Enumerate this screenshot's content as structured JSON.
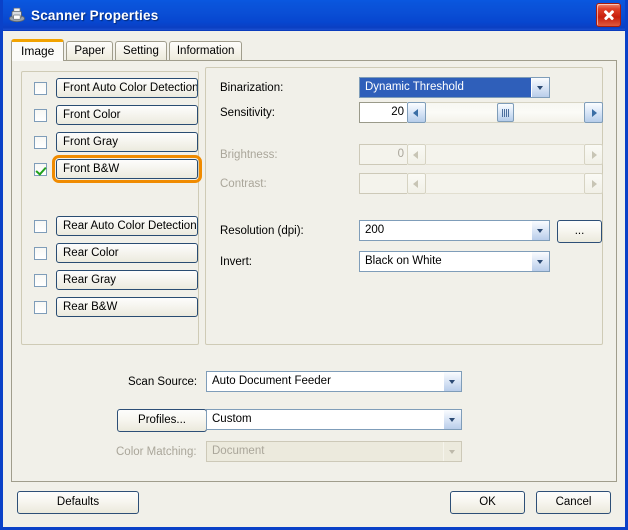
{
  "window": {
    "title": "Scanner Properties",
    "icon": "scanner-icon",
    "close_label": "",
    "accent_title_color": "#0a4fd6",
    "focus_color": "#f08b00"
  },
  "tabs": [
    {
      "label": "Image",
      "active": true
    },
    {
      "label": "Paper",
      "active": false
    },
    {
      "label": "Setting",
      "active": false
    },
    {
      "label": "Information",
      "active": false
    }
  ],
  "color_modes": {
    "front": [
      {
        "label": "Front Auto Color Detection",
        "checked": false,
        "focused": false
      },
      {
        "label": "Front Color",
        "checked": false,
        "focused": false
      },
      {
        "label": "Front Gray",
        "checked": false,
        "focused": false
      },
      {
        "label": "Front B&W",
        "checked": true,
        "focused": true
      }
    ],
    "rear": [
      {
        "label": "Rear Auto Color Detection",
        "checked": false,
        "focused": false
      },
      {
        "label": "Rear Color",
        "checked": false,
        "focused": false
      },
      {
        "label": "Rear Gray",
        "checked": false,
        "focused": false
      },
      {
        "label": "Rear B&W",
        "checked": false,
        "focused": false
      }
    ]
  },
  "settings": {
    "binarization": {
      "label": "Binarization:",
      "value": "Dynamic Threshold",
      "enabled": true,
      "text_selected": true
    },
    "sensitivity": {
      "label": "Sensitivity:",
      "value": "20",
      "enabled": true,
      "thumb_percent": 50
    },
    "brightness": {
      "label": "Brightness:",
      "value": "0",
      "enabled": false
    },
    "contrast": {
      "label": "Contrast:",
      "value": "",
      "enabled": false
    },
    "resolution": {
      "label": "Resolution (dpi):",
      "value": "200",
      "enabled": true,
      "browse_label": "..."
    },
    "invert": {
      "label": "Invert:",
      "value": "Black on White",
      "enabled": true
    }
  },
  "footer_fields": {
    "scan_source": {
      "label": "Scan Source:",
      "value": "Auto Document Feeder",
      "enabled": true
    },
    "profiles": {
      "button_label": "Profiles...",
      "value": "Custom",
      "enabled": true
    },
    "color_matching": {
      "label": "Color Matching:",
      "value": "Document",
      "enabled": false
    }
  },
  "buttons": {
    "defaults": "Defaults",
    "ok": "OK",
    "cancel": "Cancel"
  }
}
